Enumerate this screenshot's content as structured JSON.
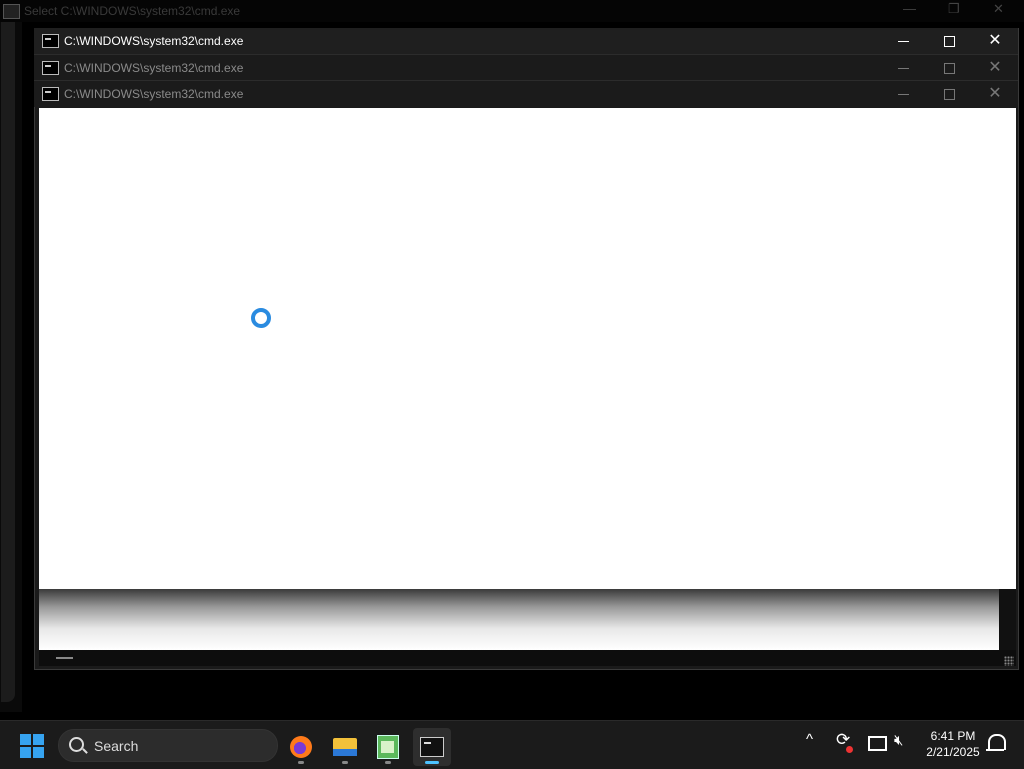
{
  "background_window": {
    "title": "Select C:\\WINDOWS\\system32\\cmd.exe"
  },
  "windows": [
    {
      "title": "C:\\WINDOWS\\system32\\cmd.exe",
      "active": true
    },
    {
      "title": "C:\\WINDOWS\\system32\\cmd.exe",
      "active": false
    },
    {
      "title": "C:\\WINDOWS\\system32\\cmd.exe",
      "active": false
    }
  ],
  "controls": {
    "minimize": "—",
    "maximize": "☐",
    "close": "✕"
  },
  "taskbar": {
    "search_label": "Search",
    "apps": [
      {
        "name": "firefox-icon",
        "active": false
      },
      {
        "name": "file-explorer-icon",
        "active": false
      },
      {
        "name": "notepad-icon",
        "active": false
      },
      {
        "name": "terminal-icon",
        "active": true
      }
    ],
    "tray": {
      "chevron": "^",
      "time": "6:41 PM",
      "date": "2/21/2025"
    }
  },
  "colors": {
    "accent": "#4cc2ff",
    "spinner": "#2a8be0",
    "start": "#36a3f0"
  }
}
